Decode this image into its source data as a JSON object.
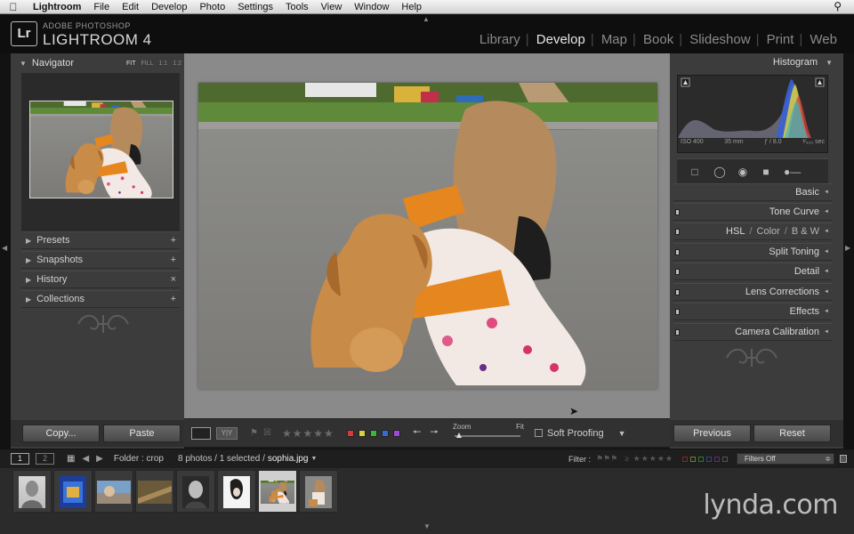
{
  "menubar": {
    "app": "Lightroom",
    "items": [
      "File",
      "Edit",
      "Develop",
      "Photo",
      "Settings",
      "Tools",
      "View",
      "Window",
      "Help"
    ]
  },
  "header": {
    "logo": "Lr",
    "brand_small": "ADOBE PHOTOSHOP",
    "brand_big": "LIGHTROOM 4",
    "modules": [
      "Library",
      "Develop",
      "Map",
      "Book",
      "Slideshow",
      "Print",
      "Web"
    ],
    "active_module": "Develop"
  },
  "left_panel": {
    "navigator": {
      "title": "Navigator",
      "zoom_options": [
        "FIT",
        "FILL",
        "1:1",
        "1:2"
      ],
      "selected_zoom": "FIT"
    },
    "sections": [
      {
        "label": "Presets",
        "action": "+"
      },
      {
        "label": "Snapshots",
        "action": "+"
      },
      {
        "label": "History",
        "action": "×"
      },
      {
        "label": "Collections",
        "action": "+"
      }
    ],
    "copy_button": "Copy...",
    "paste_button": "Paste"
  },
  "toolbar": {
    "zoom_label": "Zoom",
    "zoom_fit": "Fit",
    "soft_proofing": "Soft Proofing",
    "color_labels": [
      "#d83a3a",
      "#d8d43a",
      "#3ab83a",
      "#3a6ad8",
      "#9a4ad8"
    ]
  },
  "right_panel": {
    "histogram_title": "Histogram",
    "readout": {
      "iso": "ISO 400",
      "focal": "35 mm",
      "aperture": "ƒ / 8.0",
      "shutter": "¹⁄₃₂₀ sec"
    },
    "sections": [
      "Basic",
      "Tone Curve",
      "HSL",
      "Color",
      "B & W",
      "Split Toning",
      "Detail",
      "Lens Corrections",
      "Effects",
      "Camera Calibration"
    ],
    "previous_button": "Previous",
    "reset_button": "Reset"
  },
  "filmstrip_bar": {
    "screen1": "1",
    "screen2": "2",
    "folder": "Folder : crop",
    "count": "8 photos / 1 selected /",
    "filename": "sophia.jpg",
    "filter_label": "Filter :",
    "filter_preset": "Filters Off"
  },
  "filmstrip": {
    "thumbnail_count": 8,
    "selected_index": 6
  },
  "watermark": "lynda.com"
}
